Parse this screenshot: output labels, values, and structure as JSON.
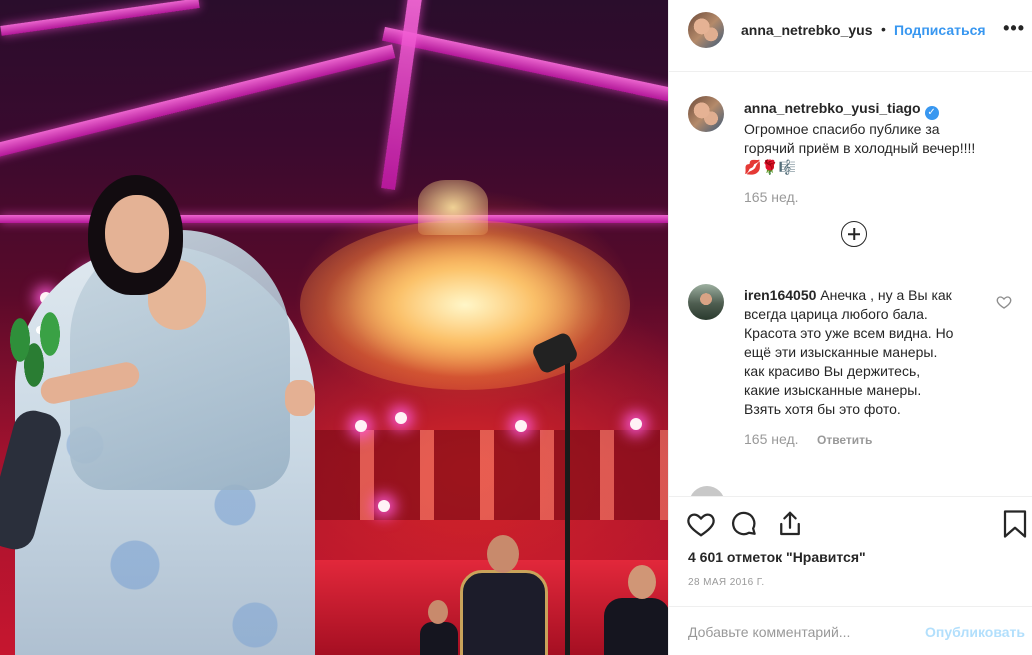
{
  "post": {
    "photo_icon": "stage-photo",
    "owner_username": "anna_netrebko_yus",
    "separator": "•",
    "follow_label": "Подписаться",
    "more_label": "•••"
  },
  "caption": {
    "username": "anna_netrebko_yusi_tiago",
    "verified_icon": "verified-badge",
    "line1": "Огромное спасибо публике за",
    "line2": "горячий приём в холодный вечер!!!!",
    "emoji": "💋🌹🎼",
    "time": "165 нед."
  },
  "load_more_icon": "plus-circle-icon",
  "comments": [
    {
      "username": "iren164050",
      "lines": [
        "Анечка , ну а Вы как",
        "всегда царица любого бала.",
        "Красота это уже всем видна. Но",
        "ещё эти изысканные манеры.",
        "как красиво Вы держитесь,",
        "какие изысканные манеры.",
        "Взять хотя бы это фото."
      ],
      "time": "165 нед.",
      "reply_label": "Ответить"
    }
  ],
  "engagement": {
    "likes": "4 601 отметок \"Нравится\"",
    "date": "28 мая 2016 г."
  },
  "comment_box": {
    "placeholder": "Добавьте комментарий...",
    "publish_label": "Опубликовать"
  },
  "colors": {
    "link": "#3897f0",
    "publish_disabled": "#b2dffc",
    "muted": "#999999"
  }
}
